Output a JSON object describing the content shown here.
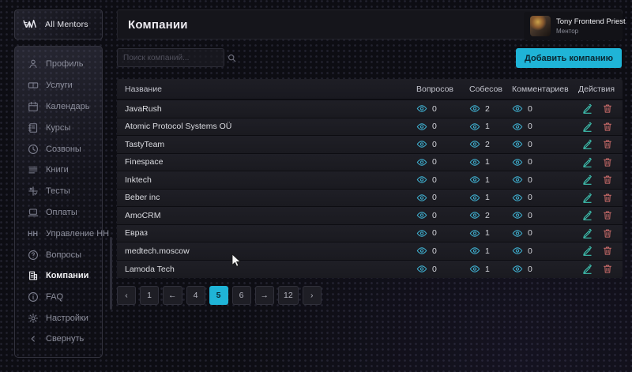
{
  "app": {
    "logo_text": "All Mentors"
  },
  "header": {
    "title": "Компании"
  },
  "user": {
    "name": "Tony Frontend Priest",
    "role": "Ментор"
  },
  "toolbar": {
    "search_placeholder": "Поиск компаний...",
    "add_button_label": "Добавить компанию"
  },
  "sidebar": {
    "items": [
      {
        "icon": "user-icon",
        "label": "Профиль",
        "active": false
      },
      {
        "icon": "ticket-icon",
        "label": "Услуги",
        "active": false
      },
      {
        "icon": "calendar-icon",
        "label": "Календарь",
        "active": false
      },
      {
        "icon": "notebook-icon",
        "label": "Курсы",
        "active": false
      },
      {
        "icon": "clock-icon",
        "label": "Созвоны",
        "active": false
      },
      {
        "icon": "lines-icon",
        "label": "Книги",
        "active": false
      },
      {
        "icon": "tests-icon",
        "label": "Тесты",
        "active": false
      },
      {
        "icon": "laptop-icon",
        "label": "Оплаты",
        "active": false
      },
      {
        "icon": "hh-icon",
        "label": "Управление HH",
        "active": false
      },
      {
        "icon": "question-icon",
        "label": "Вопросы",
        "active": false
      },
      {
        "icon": "building-icon",
        "label": "Компании",
        "active": true
      },
      {
        "icon": "info-icon",
        "label": "FAQ",
        "active": false
      },
      {
        "icon": "gear-icon",
        "label": "Настройки",
        "active": false
      }
    ],
    "collapse_label": "Свернуть"
  },
  "table": {
    "columns": {
      "name": "Название",
      "questions": "Вопросов",
      "interviews": "Собесов",
      "comments": "Комментариев",
      "actions": "Действия"
    },
    "rows": [
      {
        "name": "JavaRush",
        "questions": "0",
        "interviews": "2",
        "comments": "0"
      },
      {
        "name": "Atomic Protocol Systems OÜ",
        "questions": "0",
        "interviews": "1",
        "comments": "0"
      },
      {
        "name": "TastyTeam",
        "questions": "0",
        "interviews": "2",
        "comments": "0"
      },
      {
        "name": "Finespace",
        "questions": "0",
        "interviews": "1",
        "comments": "0"
      },
      {
        "name": "Inktech",
        "questions": "0",
        "interviews": "1",
        "comments": "0"
      },
      {
        "name": "Beber inc",
        "questions": "0",
        "interviews": "1",
        "comments": "0"
      },
      {
        "name": "AmoCRM",
        "questions": "0",
        "interviews": "2",
        "comments": "0"
      },
      {
        "name": "Евраз",
        "questions": "0",
        "interviews": "1",
        "comments": "0"
      },
      {
        "name": "medtech.moscow",
        "questions": "0",
        "interviews": "1",
        "comments": "0"
      },
      {
        "name": "Lamoda Tech",
        "questions": "0",
        "interviews": "1",
        "comments": "0"
      }
    ]
  },
  "pagination": {
    "items": [
      {
        "label": "‹",
        "active": false
      },
      {
        "label": "1",
        "active": false
      },
      {
        "label": "←",
        "active": false
      },
      {
        "label": "4",
        "active": false
      },
      {
        "label": "5",
        "active": true
      },
      {
        "label": "6",
        "active": false
      },
      {
        "label": "→",
        "active": false
      },
      {
        "label": "12",
        "active": false
      },
      {
        "label": "›",
        "active": false
      }
    ]
  },
  "colors": {
    "accent": "#1fb4d7",
    "accent_text": "#092732",
    "eye": "#3fb0d0",
    "edit": "#3ec1b0",
    "delete": "#c96b69"
  }
}
